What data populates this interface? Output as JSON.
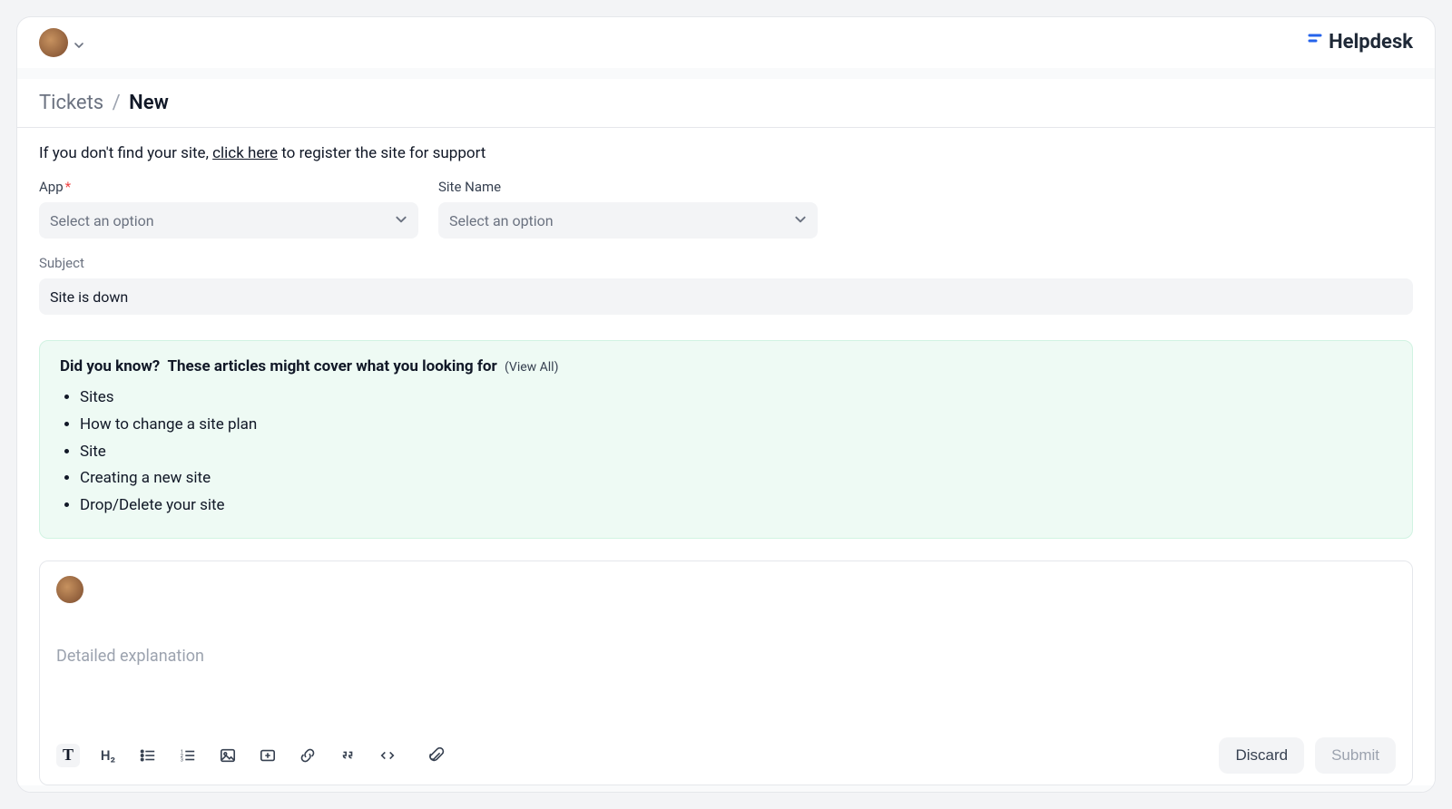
{
  "brand": {
    "name": "Helpdesk"
  },
  "breadcrumb": {
    "parent": "Tickets",
    "current": "New"
  },
  "info": {
    "prefix": "If you don't find your site, ",
    "link": "click here",
    "suffix": " to register the site for support"
  },
  "fields": {
    "app": {
      "label": "App",
      "placeholder": "Select an option",
      "required": true
    },
    "site": {
      "label": "Site Name",
      "placeholder": "Select an option",
      "required": false
    },
    "subject": {
      "label": "Subject",
      "value": "Site is down"
    }
  },
  "suggestions": {
    "lead": "Did you know?",
    "tail": "These articles might cover what you looking for",
    "view_all": "(View All)",
    "items": [
      "Sites",
      "How to change a site plan",
      "Site",
      "Creating a new site",
      "Drop/Delete your site"
    ]
  },
  "editor": {
    "placeholder": "Detailed explanation",
    "toolbar": {
      "text": "T",
      "h2": "H₂"
    },
    "buttons": {
      "discard": "Discard",
      "submit": "Submit"
    }
  }
}
